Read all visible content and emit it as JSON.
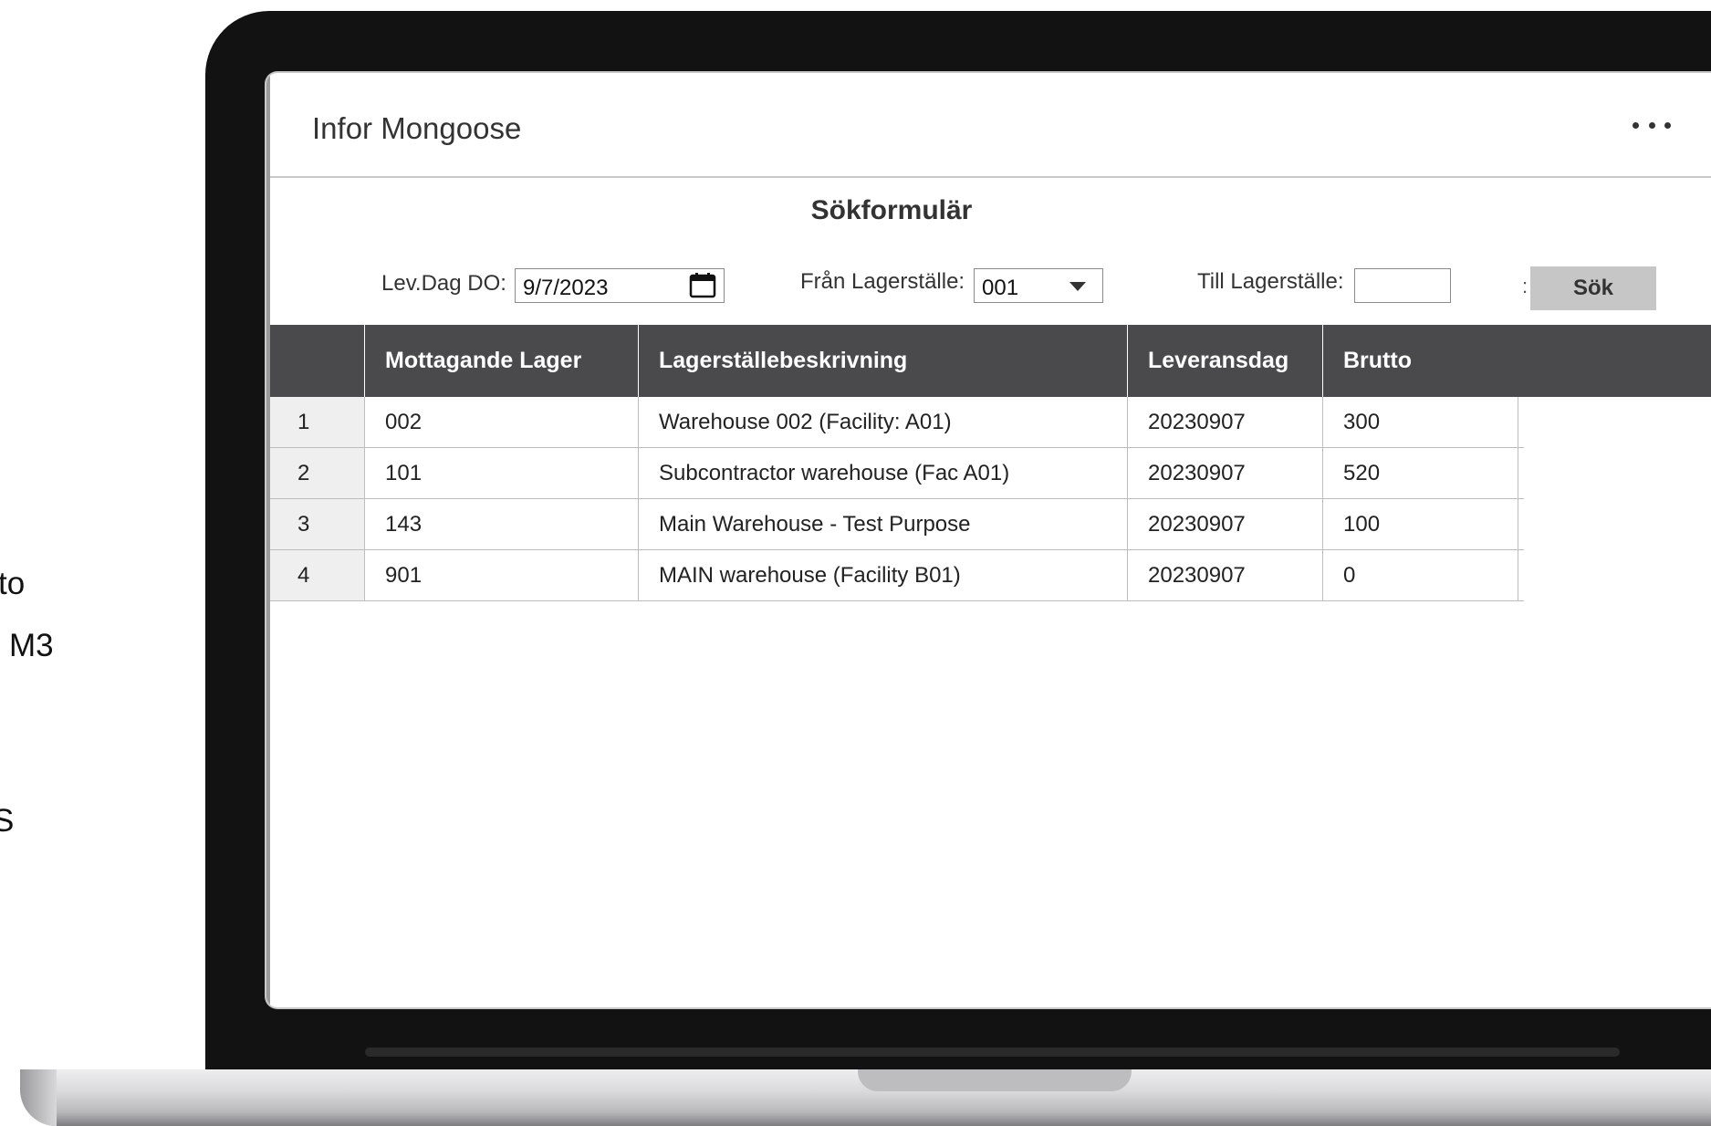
{
  "background_text": [
    "to",
    "M3",
    "S"
  ],
  "app": {
    "title": "Infor Mongoose"
  },
  "form": {
    "title": "Sökformulär",
    "date_label": "Lev.Dag DO:",
    "date_value": "9/7/2023",
    "from_label": "Från Lagerställe:",
    "from_value": "001",
    "to_label": "Till Lagerställe:",
    "to_value": "",
    "colon": ":",
    "search_label": "Sök"
  },
  "table": {
    "columns": [
      "Mottagande Lager",
      "Lagerställebeskrivning",
      "Leveransdag",
      "Brutto"
    ],
    "rows": [
      {
        "num": "1",
        "lager": "002",
        "beskrivning": "Warehouse 002 (Facility: A01)",
        "leveransdag": "20230907",
        "brutto": "300"
      },
      {
        "num": "2",
        "lager": "101",
        "beskrivning": "Subcontractor warehouse (Fac A01)",
        "leveransdag": "20230907",
        "brutto": "520"
      },
      {
        "num": "3",
        "lager": "143",
        "beskrivning": "Main Warehouse - Test Purpose",
        "leveransdag": "20230907",
        "brutto": "100"
      },
      {
        "num": "4",
        "lager": "901",
        "beskrivning": "MAIN warehouse (Facility B01)",
        "leveransdag": "20230907",
        "brutto": "0"
      }
    ]
  }
}
